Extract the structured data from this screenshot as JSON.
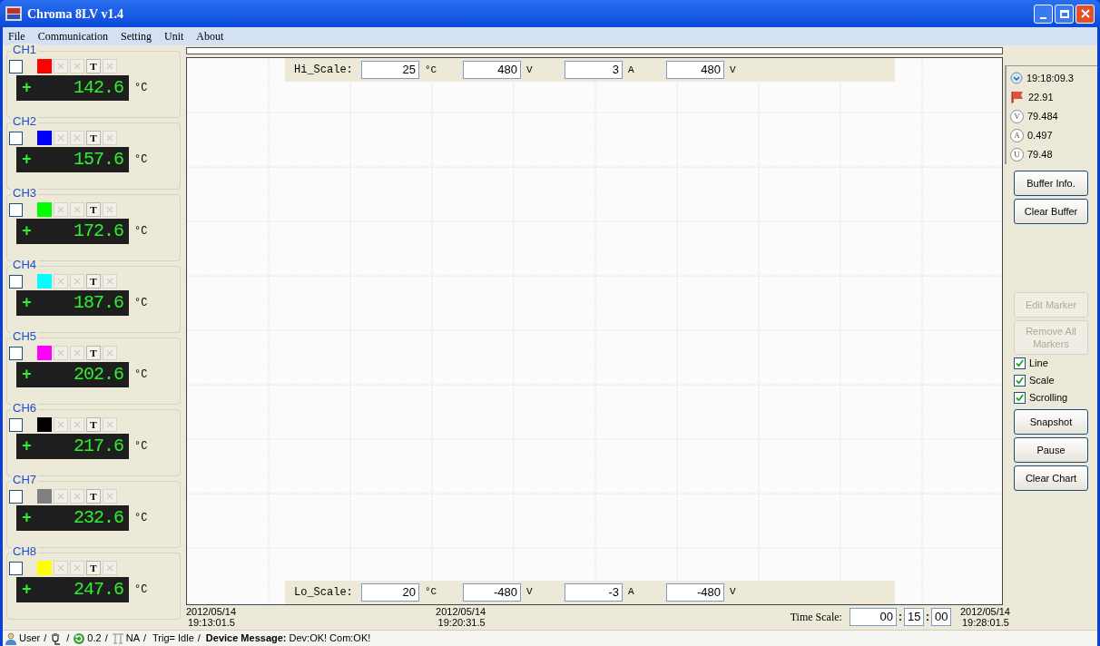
{
  "window": {
    "title": "Chroma 8LV v1.4"
  },
  "menu": [
    {
      "label": "File"
    },
    {
      "label": "Communication"
    },
    {
      "label": "Setting"
    },
    {
      "label": "Unit"
    },
    {
      "label": "About"
    }
  ],
  "channels": [
    {
      "label": "CH1",
      "checked": false,
      "color": "#ff0000",
      "mode": "T",
      "sign": "+",
      "value": "142.6",
      "unit": "°C"
    },
    {
      "label": "CH2",
      "checked": false,
      "color": "#0000ff",
      "mode": "T",
      "sign": "+",
      "value": "157.6",
      "unit": "°C"
    },
    {
      "label": "CH3",
      "checked": false,
      "color": "#00ff00",
      "mode": "T",
      "sign": "+",
      "value": "172.6",
      "unit": "°C"
    },
    {
      "label": "CH4",
      "checked": false,
      "color": "#00ffff",
      "mode": "T",
      "sign": "+",
      "value": "187.6",
      "unit": "°C"
    },
    {
      "label": "CH5",
      "checked": false,
      "color": "#ff00ff",
      "mode": "T",
      "sign": "+",
      "value": "202.6",
      "unit": "°C"
    },
    {
      "label": "CH6",
      "checked": false,
      "color": "#000000",
      "mode": "T",
      "sign": "+",
      "value": "217.6",
      "unit": "°C"
    },
    {
      "label": "CH7",
      "checked": false,
      "color": "#808080",
      "mode": "T",
      "sign": "+",
      "value": "232.6",
      "unit": "°C"
    },
    {
      "label": "CH8",
      "checked": false,
      "color": "#ffff00",
      "mode": "T",
      "sign": "+",
      "value": "247.6",
      "unit": "°C"
    }
  ],
  "hi_scale": {
    "label": "Hi_Scale:",
    "fields": [
      {
        "value": "25",
        "unit": "°C"
      },
      {
        "value": "480",
        "unit": "V"
      },
      {
        "value": "3",
        "unit": "A"
      },
      {
        "value": "480",
        "unit": "V"
      }
    ]
  },
  "lo_scale": {
    "label": "Lo_Scale:",
    "fields": [
      {
        "value": "20",
        "unit": "°C"
      },
      {
        "value": "-480",
        "unit": "V"
      },
      {
        "value": "-3",
        "unit": "A"
      },
      {
        "value": "-480",
        "unit": "V"
      }
    ]
  },
  "timestamps": [
    {
      "date": "2012/05/14",
      "time": "19:13:01.5"
    },
    {
      "date": "2012/05/14",
      "time": "19:20:31.5"
    },
    {
      "date": "2012/05/14",
      "time": "19:28:01.5"
    }
  ],
  "time_scale": {
    "label": "Time Scale:",
    "fields": [
      "00",
      "15",
      "00"
    ],
    "separator": ":"
  },
  "readings": [
    {
      "kind": "clock",
      "value": "19:18:09.3"
    },
    {
      "kind": "flag",
      "value": "22.91"
    },
    {
      "kind": "letter",
      "symbol": "V",
      "value": "79.484"
    },
    {
      "kind": "letter",
      "symbol": "A",
      "value": "0.497"
    },
    {
      "kind": "letter",
      "symbol": "U",
      "value": "79.48"
    }
  ],
  "controls": [
    {
      "kind": "button",
      "label": "Buffer Info.",
      "disabled": false
    },
    {
      "kind": "button",
      "label": "Clear Buffer",
      "disabled": false
    },
    {
      "kind": "spacer"
    },
    {
      "kind": "button",
      "label": "Edit Marker",
      "disabled": true
    },
    {
      "kind": "button",
      "label": "Remove All Markers",
      "disabled": true
    },
    {
      "kind": "checkbox",
      "label": "Line",
      "checked": true
    },
    {
      "kind": "checkbox",
      "label": "Scale",
      "checked": true
    },
    {
      "kind": "checkbox",
      "label": "Scrolling",
      "checked": true
    },
    {
      "kind": "button",
      "label": "Snapshot",
      "disabled": false
    },
    {
      "kind": "button",
      "label": "Pause",
      "disabled": false
    },
    {
      "kind": "button",
      "label": "Clear Chart",
      "disabled": false
    }
  ],
  "status_bar": [
    {
      "kind": "user",
      "text": "User"
    },
    {
      "kind": "sep",
      "text": "/"
    },
    {
      "kind": "plug"
    },
    {
      "kind": "sep",
      "text": "/"
    },
    {
      "kind": "refresh",
      "text": "0.2"
    },
    {
      "kind": "sep",
      "text": "/"
    },
    {
      "kind": "trigger",
      "text": "NA"
    },
    {
      "kind": "sep",
      "text": "/"
    },
    {
      "kind": "plain",
      "text": "Trig="
    },
    {
      "kind": "plain",
      "text": "Idle"
    },
    {
      "kind": "sep",
      "text": "/"
    },
    {
      "kind": "bold",
      "text": "Device Message:"
    },
    {
      "kind": "plain",
      "text": "Dev:OK!"
    },
    {
      "kind": "plain",
      "text": "Com:OK!"
    }
  ]
}
